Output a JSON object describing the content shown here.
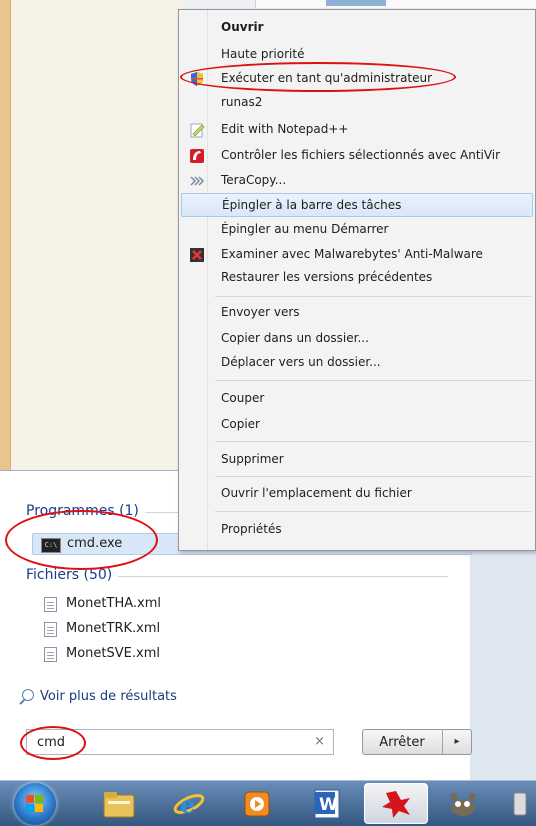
{
  "context_menu": {
    "items": [
      {
        "label": "Ouvrir",
        "bold": true,
        "icon": ""
      },
      {
        "label": "Haute priorité",
        "icon": ""
      },
      {
        "label": "Exécuter en tant qu'administrateur",
        "icon": "uac-shield-icon"
      },
      {
        "label": "runas2",
        "icon": ""
      },
      {
        "label": "Edit with Notepad++",
        "icon": "notepadpp-icon"
      },
      {
        "label": "Contrôler les fichiers sélectionnés avec AntiVir",
        "icon": "antivir-icon"
      },
      {
        "label": "TeraCopy...",
        "icon": "teracopy-icon"
      },
      {
        "label": "Épingler à la barre des tâches",
        "icon": "",
        "highlighted": true
      },
      {
        "label": "Épingler au menu Démarrer",
        "icon": ""
      },
      {
        "label": "Examiner avec Malwarebytes' Anti-Malware",
        "icon": "malwarebytes-icon"
      },
      {
        "label": "Restaurer les versions précédentes",
        "icon": ""
      },
      {
        "label": "Envoyer vers",
        "icon": ""
      },
      {
        "label": "Copier dans un dossier...",
        "icon": ""
      },
      {
        "label": "Déplacer vers un dossier...",
        "icon": ""
      },
      {
        "label": "Couper",
        "icon": ""
      },
      {
        "label": "Copier",
        "icon": ""
      },
      {
        "label": "Supprimer",
        "icon": ""
      },
      {
        "label": "Ouvrir l'emplacement du fichier",
        "icon": ""
      },
      {
        "label": "Propriétés",
        "icon": ""
      }
    ]
  },
  "start_menu": {
    "programs_title": "Programmes (1)",
    "program": {
      "label": "cmd.exe",
      "icon": "command-prompt-icon"
    },
    "files_title": "Fichiers (50)",
    "files": [
      {
        "label": "MonetTHA.xml",
        "icon": "xml-file-icon"
      },
      {
        "label": "MonetTRK.xml",
        "icon": "xml-file-icon"
      },
      {
        "label": "MonetSVE.xml",
        "icon": "xml-file-icon"
      }
    ],
    "more_results": "Voir plus de résultats",
    "search": {
      "value": "cmd",
      "clear": "×"
    },
    "stop_button": "Arrêter",
    "stop_arrow": "▸"
  },
  "taskbar": {
    "buttons": [
      "start-orb",
      "windows-explorer-icon",
      "internet-explorer-icon",
      "media-player-icon",
      "word-icon",
      "antivirus-icon",
      "gimp-icon"
    ],
    "word_letter": "W",
    "cmd_icon_text": "C:\\"
  },
  "colors": {
    "annotation": "#dd1111",
    "highlight": "#d9e7f8",
    "section_title": "#1e3a8a"
  }
}
